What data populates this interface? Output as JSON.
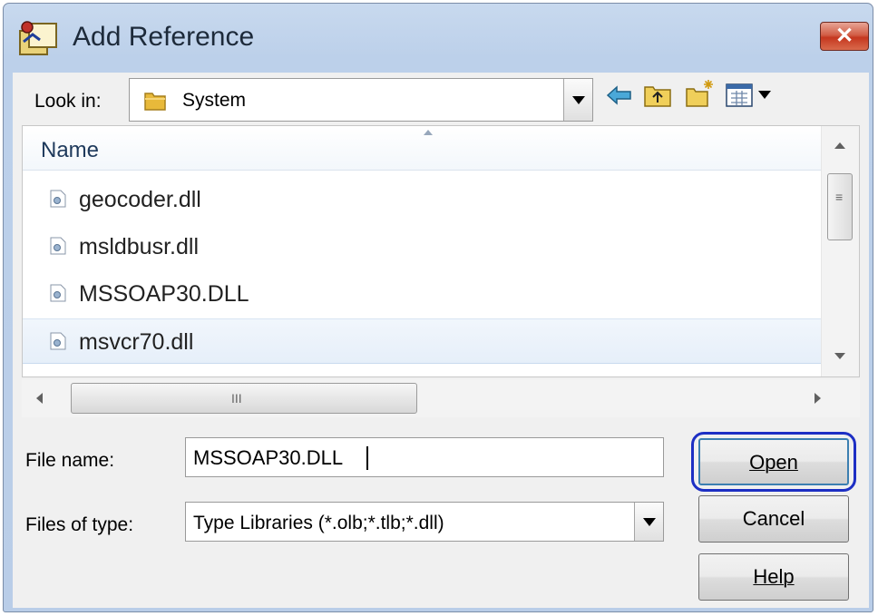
{
  "window": {
    "title": "Add Reference",
    "close_glyph": "✕"
  },
  "look_in": {
    "label": "Look in:",
    "value": "System"
  },
  "toolbar": {
    "icons": [
      "back-arrow-icon",
      "up-folder-icon",
      "new-folder-icon",
      "view-menu-icon"
    ]
  },
  "file_list": {
    "column_header": "Name",
    "items": [
      {
        "name": "geocoder.dll",
        "selected": false
      },
      {
        "name": "msldbusr.dll",
        "selected": false
      },
      {
        "name": "MSSOAP30.DLL",
        "selected": false
      },
      {
        "name": "msvcr70.dll",
        "selected": true
      }
    ],
    "h_scroll_grip": "III"
  },
  "file_name": {
    "label": "File name:",
    "value": "MSSOAP30.DLL"
  },
  "file_type": {
    "label": "Files of type:",
    "value": "Type Libraries (*.olb;*.tlb;*.dll)"
  },
  "buttons": {
    "open": "Open",
    "cancel": "Cancel",
    "help": "Help"
  },
  "colors": {
    "focus_ring": "#1d2fc4",
    "title_bar": "#bcd0ea",
    "close_button": "#c5371f"
  }
}
